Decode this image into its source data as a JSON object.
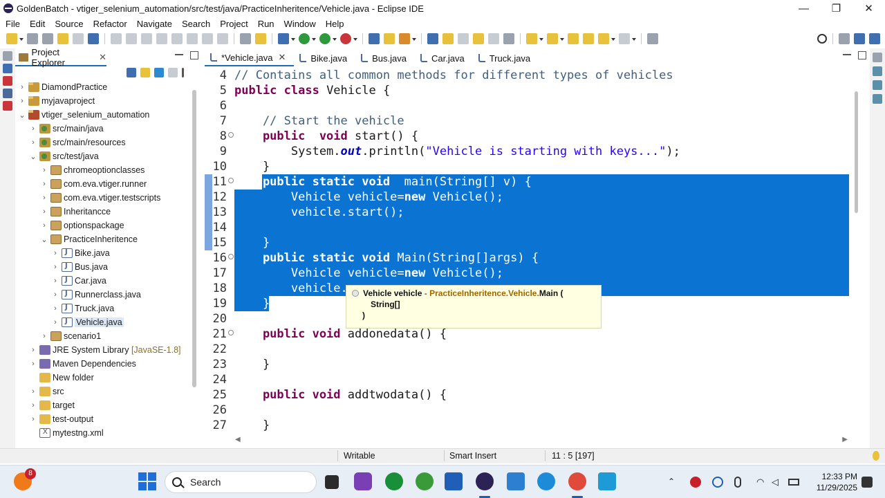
{
  "window": {
    "title": "GoldenBatch - vtiger_selenium_automation/src/test/java/PracticeInheritence/Vehicle.java - Eclipse IDE",
    "minimize": "—",
    "maximize": "❐",
    "close": "✕"
  },
  "menu": [
    "File",
    "Edit",
    "Source",
    "Refactor",
    "Navigate",
    "Search",
    "Project",
    "Run",
    "Window",
    "Help"
  ],
  "project_explorer": {
    "tab_label": "Project Explorer",
    "items": [
      {
        "label": "DiamondPractice",
        "suffix": ""
      },
      {
        "label": "myjavaproject",
        "suffix": ""
      },
      {
        "label": "vtiger_selenium_automation",
        "suffix": ""
      },
      {
        "label": "src/main/java",
        "suffix": ""
      },
      {
        "label": "src/main/resources",
        "suffix": ""
      },
      {
        "label": "src/test/java",
        "suffix": ""
      },
      {
        "label": "chromeoptionclasses",
        "suffix": ""
      },
      {
        "label": "com.eva.vtiger.runner",
        "suffix": ""
      },
      {
        "label": "com.eva.vtiger.testscripts",
        "suffix": ""
      },
      {
        "label": "Inheritancce",
        "suffix": ""
      },
      {
        "label": "optionspackage",
        "suffix": ""
      },
      {
        "label": "PracticeInheritence",
        "suffix": ""
      },
      {
        "label": "Bike.java",
        "suffix": ""
      },
      {
        "label": "Bus.java",
        "suffix": ""
      },
      {
        "label": "Car.java",
        "suffix": ""
      },
      {
        "label": "Runnerclass.java",
        "suffix": ""
      },
      {
        "label": "Truck.java",
        "suffix": ""
      },
      {
        "label": "Vehicle.java",
        "suffix": ""
      },
      {
        "label": "scenario1",
        "suffix": ""
      },
      {
        "label": "JRE System Library",
        "suffix": "[JavaSE-1.8]"
      },
      {
        "label": "Maven Dependencies",
        "suffix": ""
      },
      {
        "label": "New folder",
        "suffix": ""
      },
      {
        "label": "src",
        "suffix": ""
      },
      {
        "label": "target",
        "suffix": ""
      },
      {
        "label": "test-output",
        "suffix": ""
      },
      {
        "label": "mytestng.xml",
        "suffix": ""
      }
    ]
  },
  "editor": {
    "tabs": [
      {
        "label": "*Vehicle.java",
        "close": "✕"
      },
      {
        "label": "Bike.java"
      },
      {
        "label": "Bus.java"
      },
      {
        "label": "Car.java"
      },
      {
        "label": "Truck.java"
      }
    ],
    "lines": [
      {
        "n": "4",
        "segs": [
          {
            "t": "// Contains all common methods for different types of vehicles",
            "c": "cm"
          }
        ]
      },
      {
        "n": "5",
        "segs": [
          {
            "t": "public class ",
            "c": "kw"
          },
          {
            "t": "Vehicle {",
            "c": ""
          }
        ]
      },
      {
        "n": "6",
        "segs": []
      },
      {
        "n": "7",
        "segs": [
          {
            "t": "    // Start the vehicle",
            "c": "cm"
          }
        ]
      },
      {
        "n": "8",
        "segs": [
          {
            "t": "    public  void ",
            "c": "kw"
          },
          {
            "t": "start() {",
            "c": ""
          }
        ]
      },
      {
        "n": "9",
        "segs": [
          {
            "t": "        System.",
            "c": ""
          },
          {
            "t": "out",
            "c": "it"
          },
          {
            "t": ".println(",
            "c": ""
          },
          {
            "t": "\"Vehicle is starting with keys...\"",
            "c": "st"
          },
          {
            "t": ");",
            "c": ""
          }
        ]
      },
      {
        "n": "10",
        "segs": [
          {
            "t": "    }",
            "c": ""
          }
        ]
      },
      {
        "n": "11",
        "segs": [
          {
            "t": "    public static void ",
            "c": "kw"
          },
          {
            "t": " main(String[] v) {",
            "c": ""
          }
        ]
      },
      {
        "n": "12",
        "segs": [
          {
            "t": "        Vehicle vehicle=",
            "c": ""
          },
          {
            "t": "new ",
            "c": "kw"
          },
          {
            "t": "Vehicle();",
            "c": ""
          }
        ]
      },
      {
        "n": "13",
        "segs": [
          {
            "t": "        vehicle.start();",
            "c": ""
          }
        ]
      },
      {
        "n": "14",
        "segs": []
      },
      {
        "n": "15",
        "segs": [
          {
            "t": "    }",
            "c": ""
          }
        ]
      },
      {
        "n": "16",
        "segs": [
          {
            "t": "    public static void ",
            "c": "kw"
          },
          {
            "t": "Main(String[]args) {",
            "c": ""
          }
        ]
      },
      {
        "n": "17",
        "segs": [
          {
            "t": "        Vehicle vehicle=",
            "c": ""
          },
          {
            "t": "new ",
            "c": "kw"
          },
          {
            "t": "Vehicle();",
            "c": ""
          }
        ]
      },
      {
        "n": "18",
        "segs": [
          {
            "t": "        vehicle.",
            "c": ""
          }
        ]
      },
      {
        "n": "19",
        "segs": [
          {
            "t": "    }",
            "c": ""
          }
        ]
      },
      {
        "n": "20",
        "segs": []
      },
      {
        "n": "21",
        "segs": [
          {
            "t": "    public void ",
            "c": "kw"
          },
          {
            "t": "addonedata() {",
            "c": ""
          }
        ]
      },
      {
        "n": "22",
        "segs": []
      },
      {
        "n": "23",
        "segs": [
          {
            "t": "    }",
            "c": ""
          }
        ]
      },
      {
        "n": "24",
        "segs": []
      },
      {
        "n": "25",
        "segs": [
          {
            "t": "    public void ",
            "c": "kw"
          },
          {
            "t": "addtwodata() {",
            "c": ""
          }
        ]
      },
      {
        "n": "26",
        "segs": []
      },
      {
        "n": "27",
        "segs": [
          {
            "t": "    }",
            "c": ""
          }
        ]
      }
    ],
    "tooltip": {
      "var": "Vehicle vehicle",
      "dash": " - ",
      "qualifier": "PracticeInheritence.Vehicle.",
      "method": "Main (",
      "param": "String[]",
      "close": ")"
    }
  },
  "status": {
    "mode": "Writable",
    "insert": "Smart Insert",
    "position": "11 : 5 [197]"
  },
  "taskbar": {
    "search_placeholder": "Search",
    "weather_badge": "8",
    "time": "12:33 PM",
    "date": "11/29/2025"
  },
  "colors": {
    "selection": "#0b73d1",
    "keyword": "#7f0055",
    "comment": "#3f5f7f",
    "string": "#2a00ff",
    "tooltip_bg": "#ffffe1"
  }
}
